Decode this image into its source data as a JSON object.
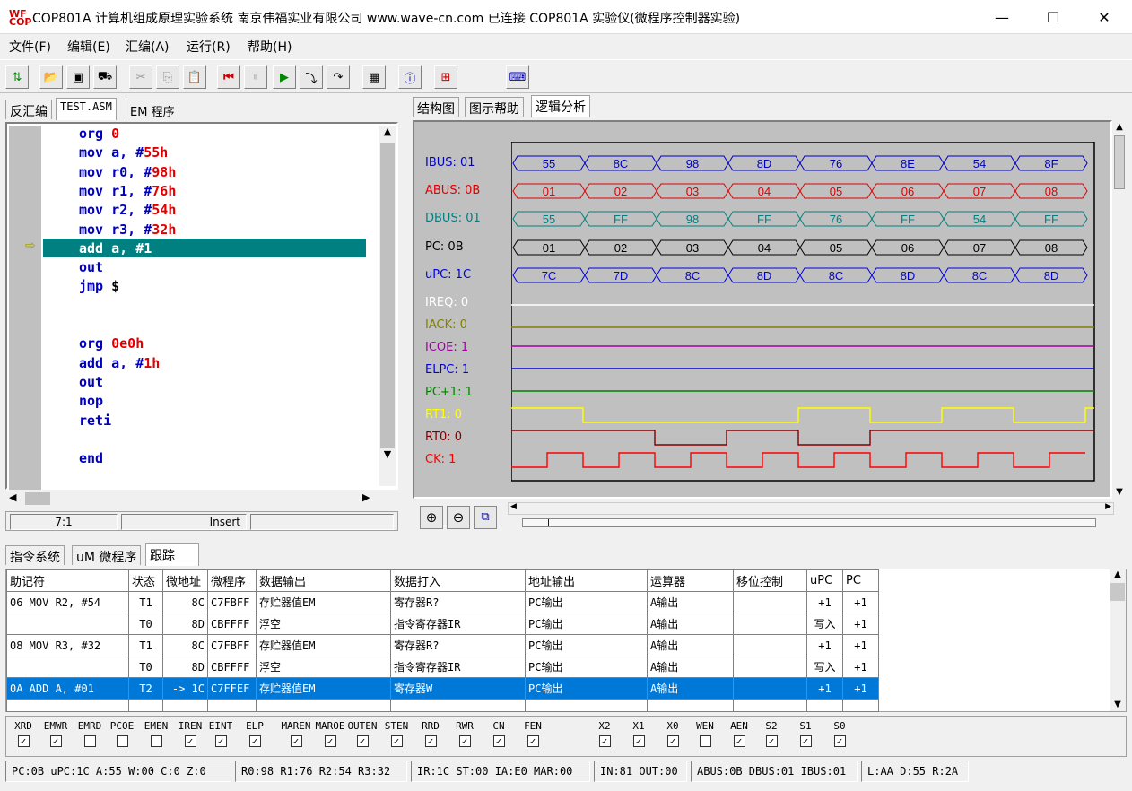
{
  "title": "COP801A 计算机组成原理实验系统  南京伟福实业有限公司  www.wave-cn.com     已连接 COP801A 实验仪(微程序控制器实验)",
  "icon_text": [
    "WF",
    "COP"
  ],
  "window": {
    "minimize": "—",
    "maximize": "☐",
    "close": "✕"
  },
  "menu": [
    "文件(F)",
    "编辑(E)",
    "汇编(A)",
    "运行(R)",
    "帮助(H)"
  ],
  "left_tabs": [
    "反汇编",
    "TEST.ASM",
    "EM 程序"
  ],
  "code_lines": [
    {
      "kw": "org ",
      "num": "0",
      "rest": ""
    },
    {
      "kw": "mov a, #",
      "num": "55h",
      "rest": ""
    },
    {
      "kw": "mov r0, #",
      "num": "98h",
      "rest": ""
    },
    {
      "kw": "mov r1, #",
      "num": "76h",
      "rest": ""
    },
    {
      "kw": "mov r2, #",
      "num": "54h",
      "rest": ""
    },
    {
      "kw": "mov r3, #",
      "num": "32h",
      "rest": ""
    },
    {
      "kw": "add a, #1",
      "num": "",
      "rest": ""
    },
    {
      "kw": "out",
      "num": "",
      "rest": ""
    },
    {
      "kw": "jmp ",
      "num": "",
      "rest": "$"
    },
    {
      "kw": "",
      "num": "",
      "rest": ""
    },
    {
      "kw": "",
      "num": "",
      "rest": ""
    },
    {
      "kw": "org ",
      "num": "0e0h",
      "rest": ""
    },
    {
      "kw": "add a, #",
      "num": "1h",
      "rest": ""
    },
    {
      "kw": "out",
      "num": "",
      "rest": ""
    },
    {
      "kw": "nop",
      "num": "",
      "rest": ""
    },
    {
      "kw": "reti",
      "num": "",
      "rest": ""
    },
    {
      "kw": "",
      "num": "",
      "rest": ""
    },
    {
      "kw": "end",
      "num": "",
      "rest": ""
    }
  ],
  "current_line_marker": "⇨",
  "editor_status": {
    "pos": "7:1",
    "mode": "Insert"
  },
  "right_tabs": [
    "结构图",
    "图示帮助",
    "逻辑分析"
  ],
  "signals": [
    {
      "label": "IBUS: 01",
      "color": "#0000c0",
      "values": [
        "55",
        "8C",
        "98",
        "8D",
        "76",
        "8E",
        "54",
        "8F"
      ]
    },
    {
      "label": "ABUS: 0B",
      "color": "#e00000",
      "values": [
        "01",
        "02",
        "03",
        "04",
        "05",
        "06",
        "07",
        "08"
      ]
    },
    {
      "label": "DBUS: 01",
      "color": "#008080",
      "values": [
        "55",
        "FF",
        "98",
        "FF",
        "76",
        "FF",
        "54",
        "FF"
      ]
    },
    {
      "label": "PC: 0B",
      "color": "#000000",
      "values": [
        "01",
        "02",
        "03",
        "04",
        "05",
        "06",
        "07",
        "08"
      ]
    },
    {
      "label": "uPC: 1C",
      "color": "#0000e0",
      "values": [
        "7C",
        "7D",
        "8C",
        "8D",
        "8C",
        "8D",
        "8C",
        "8D"
      ]
    },
    {
      "label": "IREQ: 0",
      "color": "#ffffff"
    },
    {
      "label": "IACK: 0",
      "color": "#808000"
    },
    {
      "label": "ICOE: 1",
      "color": "#a000a0"
    },
    {
      "label": "ELPC: 1",
      "color": "#0000e0"
    },
    {
      "label": "PC+1: 1",
      "color": "#008000"
    },
    {
      "label": "RT1: 0",
      "color": "#ffff00"
    },
    {
      "label": "RT0: 0",
      "color": "#800000"
    },
    {
      "label": "CK: 1",
      "color": "#ff0000"
    }
  ],
  "bottom_tabs": [
    "指令系统",
    "uM 微程序",
    "跟踪"
  ],
  "trace_headers": [
    "助记符",
    "状态",
    "微地址",
    "微程序",
    "数据输出",
    "数据打入",
    "地址输出",
    "运算器",
    "移位控制",
    "uPC",
    "PC"
  ],
  "trace_rows": [
    [
      "06 MOV    R2, #54",
      "T1",
      "8C",
      "C7FBFF",
      "存贮器值EM",
      "寄存器R?",
      "PC输出",
      "A输出",
      "",
      "+1",
      "+1"
    ],
    [
      "",
      "T0",
      "8D",
      "CBFFFF",
      "浮空",
      "指令寄存器IR",
      "PC输出",
      "A输出",
      "",
      "写入",
      "+1"
    ],
    [
      "08 MOV    R3, #32",
      "T1",
      "8C",
      "C7FBFF",
      "存贮器值EM",
      "寄存器R?",
      "PC输出",
      "A输出",
      "",
      "+1",
      "+1"
    ],
    [
      "",
      "T0",
      "8D",
      "CBFFFF",
      "浮空",
      "指令寄存器IR",
      "PC输出",
      "A输出",
      "",
      "写入",
      "+1"
    ],
    [
      "0A ADD    A, #01",
      "T2",
      "-> 1C",
      "C7FFEF",
      "存贮器值EM",
      "寄存器W",
      "PC输出",
      "A输出",
      "",
      "+1",
      "+1"
    ]
  ],
  "ctrl_signals": [
    {
      "n": "XRD",
      "c": true
    },
    {
      "n": "EMWR",
      "c": true
    },
    {
      "n": "EMRD",
      "c": false
    },
    {
      "n": "PCOE",
      "c": false
    },
    {
      "n": "EMEN",
      "c": false
    },
    {
      "n": "IREN",
      "c": true
    },
    {
      "n": "EINT",
      "c": true
    },
    {
      "n": "ELP",
      "c": true
    },
    {
      "n": "MAREN",
      "c": true
    },
    {
      "n": "MAROE",
      "c": true
    },
    {
      "n": "OUTEN",
      "c": true
    },
    {
      "n": "STEN",
      "c": true
    },
    {
      "n": "RRD",
      "c": true
    },
    {
      "n": "RWR",
      "c": true
    },
    {
      "n": "CN",
      "c": true
    },
    {
      "n": "FEN",
      "c": true
    },
    {
      "n": "X2",
      "c": true
    },
    {
      "n": "X1",
      "c": true
    },
    {
      "n": "X0",
      "c": true
    },
    {
      "n": "WEN",
      "c": false
    },
    {
      "n": "AEN",
      "c": true
    },
    {
      "n": "S2",
      "c": true
    },
    {
      "n": "S1",
      "c": true
    },
    {
      "n": "S0",
      "c": true
    }
  ],
  "status": [
    "PC:0B  uPC:1C  A:55  W:00  C:0  Z:0",
    "R0:98  R1:76  R2:54  R3:32",
    "IR:1C  ST:00  IA:E0  MAR:00",
    "IN:81  OUT:00",
    "ABUS:0B  DBUS:01  IBUS:01",
    "L:AA  D:55  R:2A"
  ]
}
